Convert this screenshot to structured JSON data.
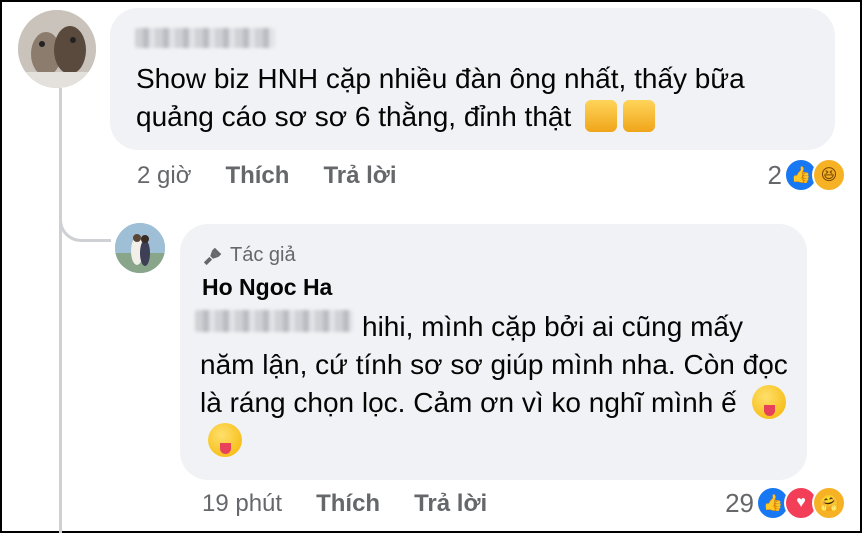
{
  "comment": {
    "text": "Show biz HNH cặp nhiều đàn ông nhất, thấy bữa quảng cáo sơ sơ 6 thằng, đỉnh thật",
    "time": "2 giờ",
    "like_label": "Thích",
    "reply_label": "Trả lời",
    "reaction_count": "2",
    "reactions": [
      "like",
      "haha"
    ],
    "emojis": [
      "thumbs-up",
      "thumbs-up"
    ]
  },
  "reply": {
    "author_badge": "Tác giả",
    "author_name": "Ho Ngoc Ha",
    "text": "hihi, mình cặp bởi ai cũng mấy năm lận, cứ tính sơ sơ giúp mình nha. Còn đọc là ráng chọn lọc. Cảm ơn vì ko nghĩ mình ế",
    "time": "19 phút",
    "like_label": "Thích",
    "reply_label": "Trả lời",
    "reaction_count": "29",
    "reactions": [
      "like",
      "love",
      "care"
    ],
    "emojis": [
      "zany-face",
      "zany-face"
    ]
  },
  "colors": {
    "bubble": "#f0f2f5",
    "meta_text": "#65676b",
    "like_blue": "#1877f2",
    "love_red": "#f33e58",
    "thread_line": "#ced0d4"
  }
}
